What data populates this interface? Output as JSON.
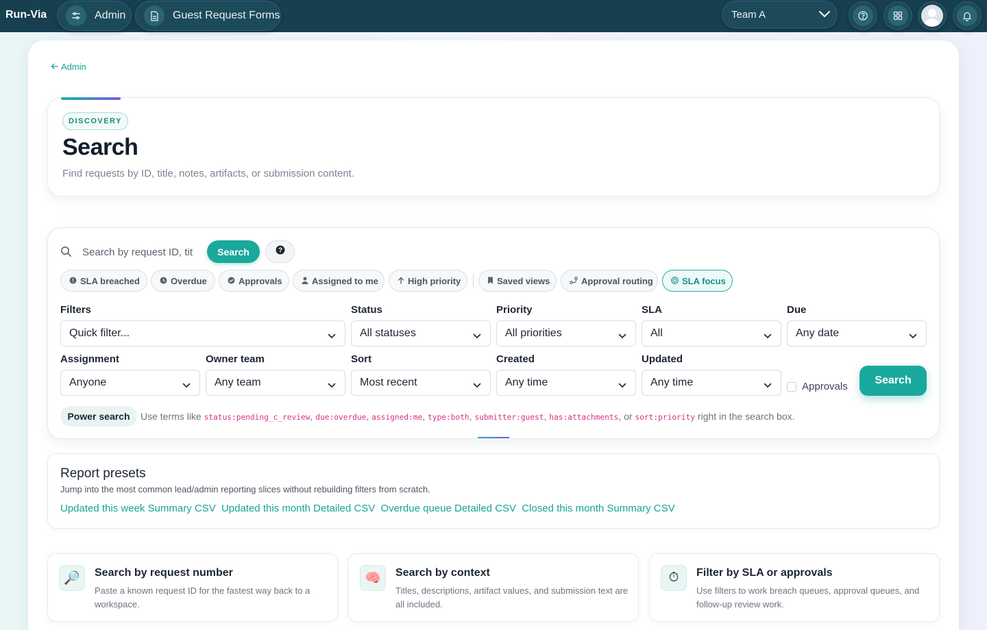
{
  "topbar": {
    "brand": "Run-Via",
    "nav": [
      {
        "label": "Admin",
        "icon": "sliders-icon"
      },
      {
        "label": "Guest Request Forms",
        "icon": "document-icon"
      }
    ],
    "team_select": "Team A",
    "icons": [
      "help-icon",
      "apps-grid-icon",
      "avatar",
      "bell-icon"
    ]
  },
  "back_link": "Admin",
  "header": {
    "kicker": "DISCOVERY",
    "title": "Search",
    "subtitle": "Find requests by ID, title, notes, artifacts, or submission content."
  },
  "search": {
    "placeholder": "Search by request ID, title, notes",
    "button": "Search",
    "help_glyph": "?"
  },
  "chips": [
    {
      "label": "SLA breached",
      "icon": "alert-circle-icon"
    },
    {
      "label": "Overdue",
      "icon": "clock-icon"
    },
    {
      "label": "Approvals",
      "icon": "check-circle-icon"
    },
    {
      "label": "Assigned to me",
      "icon": "person-icon"
    },
    {
      "label": "High priority",
      "icon": "arrow-up-icon"
    },
    {
      "label": "Saved views",
      "icon": "bookmark-icon"
    },
    {
      "label": "Approval routing",
      "icon": "routing-icon"
    },
    {
      "label": "SLA focus",
      "icon": "target-icon",
      "active": true
    }
  ],
  "filters": {
    "filters_label": "Filters",
    "filters_value": "Quick filter...",
    "status_label": "Status",
    "status_value": "All statuses",
    "priority_label": "Priority",
    "priority_value": "All priorities",
    "sla_label": "SLA",
    "sla_value": "All",
    "due_label": "Due",
    "due_value": "Any date",
    "assignment_label": "Assignment",
    "assignment_value": "Anyone",
    "owner_label": "Owner team",
    "owner_value": "Any team",
    "sort_label": "Sort",
    "sort_value": "Most recent",
    "created_label": "Created",
    "created_value": "Any time",
    "updated_label": "Updated",
    "updated_value": "Any time",
    "approvals_label": "Approvals",
    "approvals_checked": false,
    "search_button": "Search"
  },
  "power_search": {
    "label": "Power search",
    "prefix": "Use terms like ",
    "terms": [
      "status:pending_c_review",
      "due:overdue",
      "assigned:me",
      "type:both",
      "submitter:guest",
      "has:attachments",
      "sort:priority"
    ],
    "suffix": " right in the search box."
  },
  "report_presets": {
    "title": "Report presets",
    "subtitle": "Jump into the most common lead/admin reporting slices without rebuilding filters from scratch.",
    "links": [
      "Updated this week Summary CSV",
      "Updated this month Detailed CSV",
      "Overdue queue Detailed CSV",
      "Closed this month Summary CSV"
    ]
  },
  "features": [
    {
      "icon": "magnifier-icon",
      "glyph": "🔎",
      "title": "Search by request number",
      "desc": "Paste a known request ID for the fastest way back to a workspace."
    },
    {
      "icon": "brain-icon",
      "glyph": "🧠",
      "title": "Search by context",
      "desc": "Titles, descriptions, artifact values, and submission text are all included."
    },
    {
      "icon": "stopwatch-icon",
      "glyph": "⏱",
      "title": "Filter by SLA or approvals",
      "desc": "Use filters to work breach queues, approval queues, and follow-up review work."
    }
  ],
  "colors": {
    "topbar": "#173f4f",
    "accent": "#1aa89d",
    "code": "#d63384"
  }
}
